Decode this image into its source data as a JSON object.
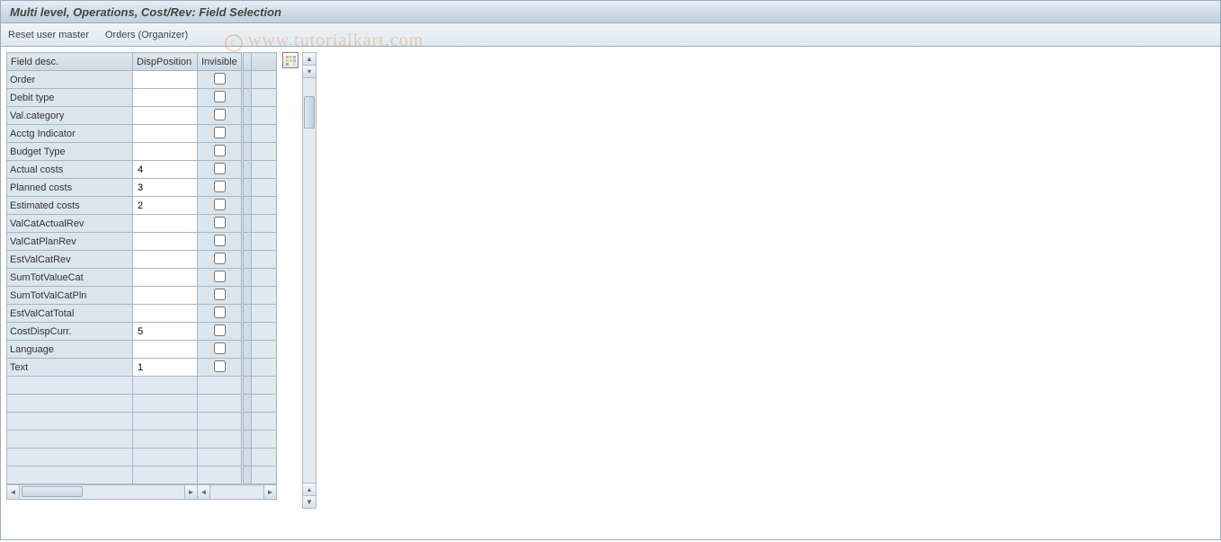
{
  "title": "Multi level, Operations, Cost/Rev: Field Selection",
  "toolbar": {
    "reset_label": "Reset user master",
    "orders_label": "Orders (Organizer)"
  },
  "columns": {
    "field_desc": "Field desc.",
    "disp_position": "DispPosition",
    "invisible": "Invisible"
  },
  "rows": [
    {
      "desc": "Order",
      "disp": "",
      "inv": false
    },
    {
      "desc": "Debit type",
      "disp": "",
      "inv": false
    },
    {
      "desc": "Val.category",
      "disp": "",
      "inv": false
    },
    {
      "desc": "Acctg Indicator",
      "disp": "",
      "inv": false
    },
    {
      "desc": "Budget Type",
      "disp": "",
      "inv": false
    },
    {
      "desc": "Actual costs",
      "disp": "4",
      "inv": false
    },
    {
      "desc": "Planned costs",
      "disp": "3",
      "inv": false
    },
    {
      "desc": "Estimated costs",
      "disp": "2",
      "inv": false
    },
    {
      "desc": "ValCatActualRev",
      "disp": "",
      "inv": false
    },
    {
      "desc": "ValCatPlanRev",
      "disp": "",
      "inv": false
    },
    {
      "desc": "EstValCatRev",
      "disp": "",
      "inv": false
    },
    {
      "desc": "SumTotValueCat",
      "disp": "",
      "inv": false
    },
    {
      "desc": "SumTotValCatPln",
      "disp": "",
      "inv": false
    },
    {
      "desc": "EstValCatTotal",
      "disp": "",
      "inv": false
    },
    {
      "desc": "CostDispCurr.",
      "disp": "5",
      "inv": false
    },
    {
      "desc": "Language",
      "disp": "",
      "inv": false
    },
    {
      "desc": "Text",
      "disp": "1",
      "inv": false
    }
  ],
  "empty_rows": 6,
  "watermark": "www.tutorialkart.com"
}
